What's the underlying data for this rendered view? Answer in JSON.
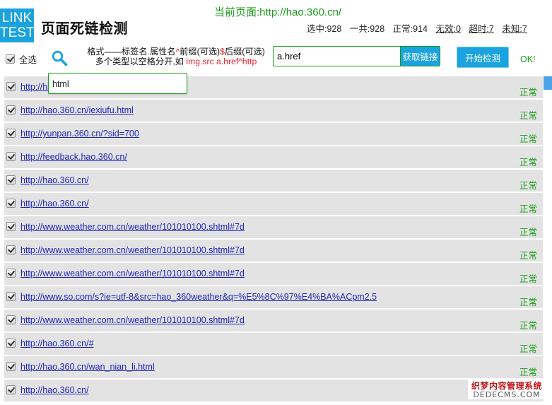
{
  "logo": {
    "line1": "LINK",
    "line2": "TEST"
  },
  "app_title": "页面死链检测",
  "current_page": "当前页面:http://hao.360.cn/",
  "stats": {
    "selected": "选中:928",
    "total": "一共:928",
    "normal": "正常:914",
    "invalid": "无效:0",
    "timeout": "超时:7",
    "unknown": "未知:7"
  },
  "toolbar": {
    "select_all": "全选",
    "hint_line1_a": "格式——标签名",
    "hint_line1_dot": ".",
    "hint_line1_b": "属性名",
    "hint_line1_caret": "^",
    "hint_line1_c": "前缀(可选)",
    "hint_line1_dollar": "$",
    "hint_line1_d": "后缀(可选)",
    "hint_line2_a": "多个类型以空格分开,如",
    "hint_line2_example": "img.src  a.href^http",
    "selector_value": "a.href",
    "fetch_label": "获取链接",
    "start_label": "开始检测",
    "ok_label": "OK!"
  },
  "suggestion": "html",
  "rows": [
    {
      "url": "http://hao.360.cn/",
      "status": "正常"
    },
    {
      "url": "http://hao.360.cn/iexiufu.html",
      "status": "正常"
    },
    {
      "url": "http://yunpan.360.cn/?sid=700",
      "status": "正常"
    },
    {
      "url": "http://feedback.hao.360.cn/",
      "status": "正常"
    },
    {
      "url": "http://hao.360.cn/",
      "status": "正常"
    },
    {
      "url": "http://hao.360.cn/",
      "status": "正常"
    },
    {
      "url": "http://www.weather.com.cn/weather/101010100.shtml#7d",
      "status": "正常"
    },
    {
      "url": "http://www.weather.com.cn/weather/101010100.shtml#7d",
      "status": "正常"
    },
    {
      "url": "http://www.weather.com.cn/weather/101010100.shtml#7d",
      "status": "正常"
    },
    {
      "url": "http://www.so.com/s?ie=utf-8&src=hao_360weather&q=%E5%8C%97%E4%BA%ACpm2.5",
      "status": "正常"
    },
    {
      "url": "http://www.weather.com.cn/weather/101010100.shtml#7d",
      "status": "正常"
    },
    {
      "url": "http://hao.360.cn/#",
      "status": "正常"
    },
    {
      "url": "http://hao.360.cn/wan_nian_li.html",
      "status": "正常"
    },
    {
      "url": "http://hao.360.cn/",
      "status": "正常"
    }
  ],
  "watermark": {
    "line1": "织梦内容管理系统",
    "line2": "DEDECMS.COM"
  },
  "colors": {
    "accent_blue": "#1aa3de",
    "ok_green": "#1a9d1a",
    "link_blue": "#1d25b8",
    "hint_red": "#e8202a",
    "row_gray": "#e3e3e3"
  }
}
